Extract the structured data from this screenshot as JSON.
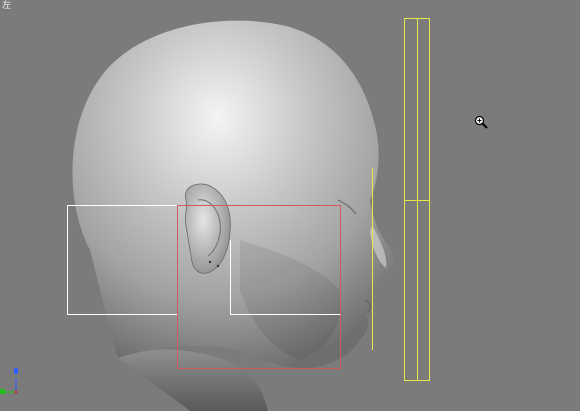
{
  "viewport": {
    "label": "左"
  },
  "colors": {
    "background": "#7b7b7b",
    "selection_white": "#ffffff",
    "selection_red": "#d05a5a",
    "helper_yellow": "#e6e84a",
    "axis_x": "#e02020",
    "axis_y": "#20c020",
    "axis_z": "#3060ff"
  },
  "icons": {
    "cursor": "zoom-cursor-icon",
    "axis_gizmo": "axis-tripod-icon"
  }
}
